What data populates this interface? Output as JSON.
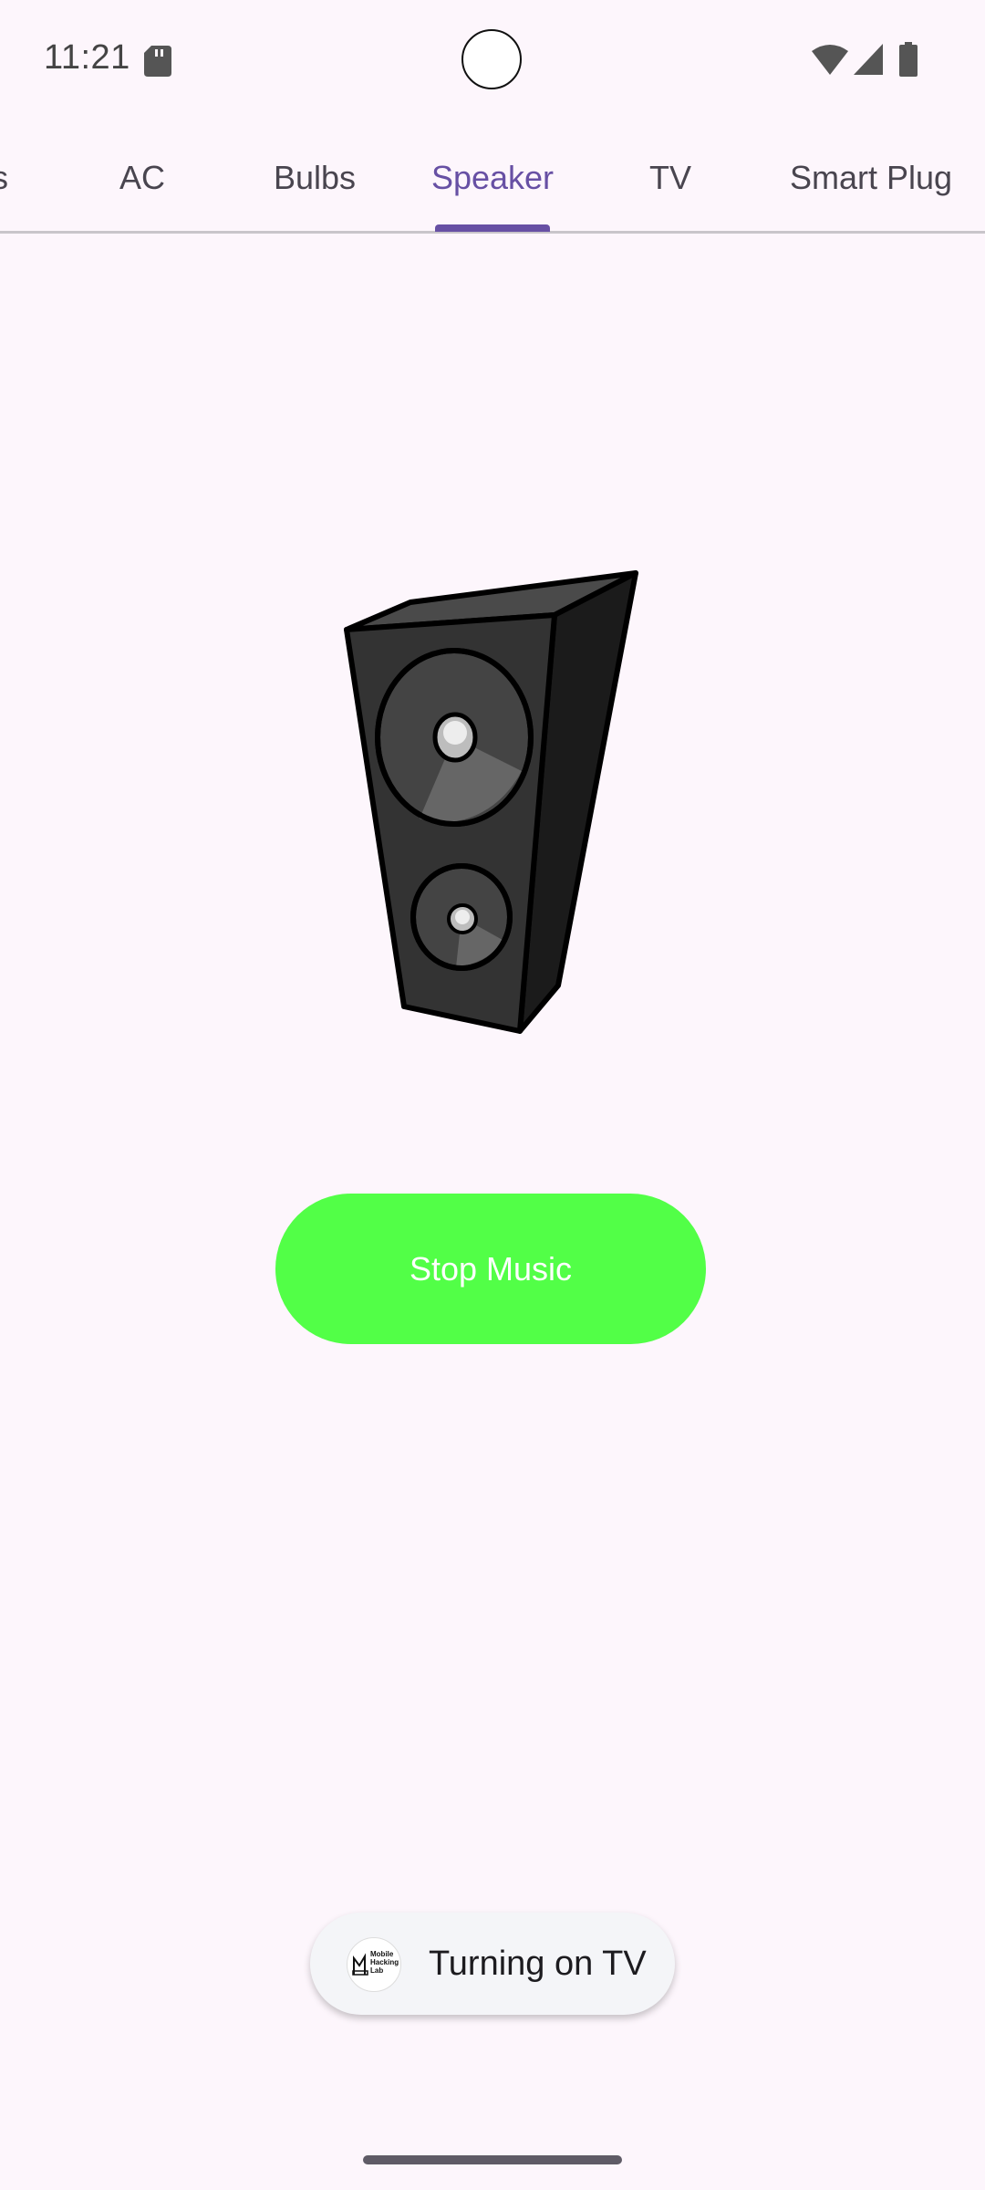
{
  "status_bar": {
    "time": "11:21"
  },
  "tabs": {
    "items": [
      {
        "label": "s"
      },
      {
        "label": "AC"
      },
      {
        "label": "Bulbs"
      },
      {
        "label": "Speaker"
      },
      {
        "label": "TV"
      },
      {
        "label": "Smart Plug"
      }
    ],
    "active": "Speaker"
  },
  "main": {
    "stop_button_label": "Stop Music"
  },
  "toast": {
    "message": "Turning on TV",
    "logo_text": [
      "Mobile",
      "Hacking",
      "Lab"
    ]
  },
  "colors": {
    "accent": "#6750A4",
    "button": "#52FF47",
    "background": "#FDF6FC"
  }
}
